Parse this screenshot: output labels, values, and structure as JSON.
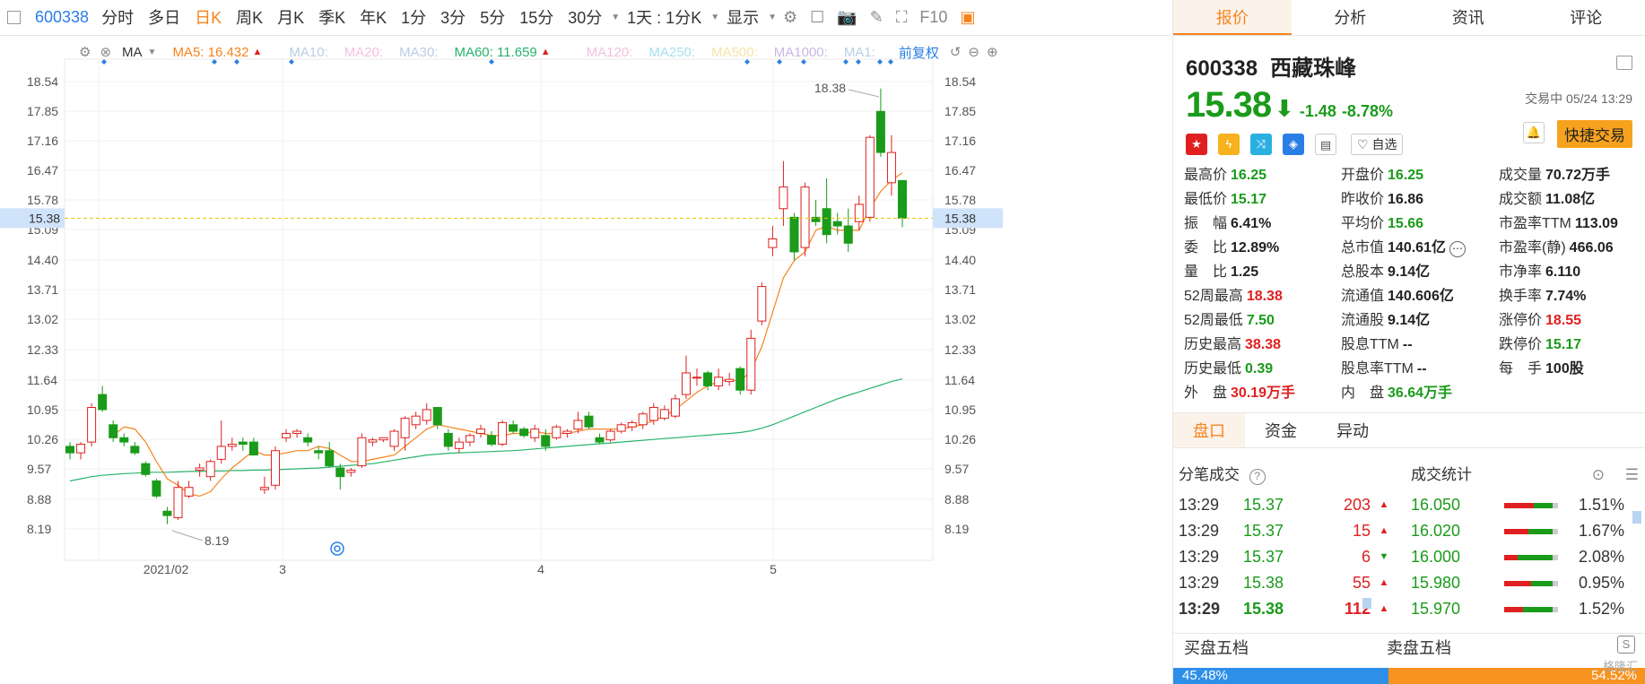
{
  "topbar": {
    "code": "600338",
    "periods": [
      "分时",
      "多日",
      "日K",
      "周K",
      "月K",
      "季K",
      "年K",
      "1分",
      "3分",
      "5分",
      "15分",
      "30分"
    ],
    "active_period": "日K",
    "multi_label": "1天 : 1分K",
    "display_label": "显示",
    "f10_label": "F10"
  },
  "indicator_bar": {
    "ma_label": "MA",
    "ma5": "MA5: 16.432",
    "ma10": "MA10:",
    "ma20": "MA20:",
    "ma30": "MA30:",
    "ma60": "MA60: 11.659",
    "ma120": "MA120:",
    "ma250": "MA250:",
    "ma500": "MA500:",
    "ma1000": "MA1000:",
    "ma1x": "MA1:",
    "adjust": "前复权"
  },
  "colors": {
    "up": "#e02020",
    "down": "#1a9b1a",
    "ma5": "#f7831e",
    "ma60": "#27b36c",
    "accent": "#f7831e"
  },
  "chart_data": {
    "type": "candlestick",
    "y_ticks": [
      "18.54",
      "17.85",
      "17.16",
      "16.47",
      "15.78",
      "15.09",
      "14.40",
      "13.71",
      "13.02",
      "12.33",
      "11.64",
      "10.95",
      "10.26",
      "9.57",
      "8.88",
      "8.19"
    ],
    "x_labels": [
      "2021/02",
      "3",
      "4",
      "5"
    ],
    "current_price_label": "15.38",
    "high_label": "18.38",
    "low_label": "8.19",
    "ylim": [
      7.9,
      18.9
    ],
    "candles": [
      [
        10.1,
        10.2,
        9.8,
        9.95
      ],
      [
        9.95,
        10.2,
        9.8,
        10.15
      ],
      [
        10.2,
        11.1,
        10.1,
        11.0
      ],
      [
        11.3,
        11.5,
        10.9,
        10.95
      ],
      [
        10.6,
        10.7,
        10.2,
        10.3
      ],
      [
        10.3,
        10.4,
        10.1,
        10.2
      ],
      [
        10.1,
        10.2,
        9.9,
        9.95
      ],
      [
        9.7,
        9.75,
        9.4,
        9.45
      ],
      [
        9.3,
        9.35,
        8.9,
        8.95
      ],
      [
        8.6,
        8.7,
        8.3,
        8.5
      ],
      [
        8.45,
        9.3,
        8.4,
        9.15
      ],
      [
        8.95,
        9.3,
        8.9,
        9.15
      ],
      [
        9.55,
        9.7,
        9.4,
        9.6
      ],
      [
        9.4,
        9.8,
        9.3,
        9.75
      ],
      [
        9.8,
        10.7,
        9.7,
        10.1
      ],
      [
        10.1,
        10.3,
        10.0,
        10.15
      ],
      [
        10.2,
        10.3,
        10.0,
        10.15
      ],
      [
        10.2,
        10.3,
        9.9,
        9.9
      ],
      [
        9.1,
        9.4,
        9.0,
        9.15
      ],
      [
        9.2,
        10.1,
        9.1,
        10.0
      ],
      [
        10.3,
        10.5,
        10.2,
        10.4
      ],
      [
        10.4,
        10.5,
        10.3,
        10.45
      ],
      [
        10.3,
        10.4,
        10.1,
        10.2
      ],
      [
        10.0,
        10.1,
        9.8,
        9.95
      ],
      [
        10.0,
        10.2,
        9.6,
        9.65
      ],
      [
        9.6,
        9.7,
        9.1,
        9.4
      ],
      [
        9.5,
        9.6,
        9.4,
        9.55
      ],
      [
        9.65,
        10.4,
        9.6,
        10.3
      ],
      [
        10.2,
        10.3,
        10.1,
        10.25
      ],
      [
        10.25,
        10.3,
        10.2,
        10.3
      ],
      [
        10.1,
        10.5,
        10.0,
        10.45
      ],
      [
        10.3,
        10.8,
        10.0,
        10.75
      ],
      [
        10.6,
        10.9,
        10.5,
        10.8
      ],
      [
        10.7,
        11.1,
        10.6,
        10.95
      ],
      [
        11.0,
        11.0,
        10.5,
        10.6
      ],
      [
        10.4,
        10.5,
        10.0,
        10.1
      ],
      [
        10.05,
        10.3,
        9.95,
        10.2
      ],
      [
        10.2,
        10.4,
        10.1,
        10.35
      ],
      [
        10.4,
        10.6,
        10.3,
        10.5
      ],
      [
        10.35,
        10.45,
        10.1,
        10.15
      ],
      [
        10.15,
        10.7,
        10.1,
        10.65
      ],
      [
        10.6,
        10.7,
        10.4,
        10.45
      ],
      [
        10.5,
        10.55,
        10.3,
        10.35
      ],
      [
        10.3,
        10.6,
        10.2,
        10.5
      ],
      [
        10.35,
        10.5,
        10.0,
        10.1
      ],
      [
        10.3,
        10.6,
        10.25,
        10.55
      ],
      [
        10.4,
        10.5,
        10.3,
        10.45
      ],
      [
        10.5,
        10.9,
        10.4,
        10.7
      ],
      [
        10.8,
        10.9,
        10.5,
        10.55
      ],
      [
        10.3,
        10.4,
        10.15,
        10.2
      ],
      [
        10.25,
        10.5,
        10.2,
        10.45
      ],
      [
        10.45,
        10.65,
        10.4,
        10.6
      ],
      [
        10.55,
        10.7,
        10.45,
        10.65
      ],
      [
        10.6,
        10.9,
        10.5,
        10.85
      ],
      [
        10.7,
        11.1,
        10.6,
        11.0
      ],
      [
        10.75,
        11.05,
        10.7,
        10.95
      ],
      [
        10.8,
        11.3,
        10.75,
        11.2
      ],
      [
        11.3,
        12.2,
        11.2,
        11.8
      ],
      [
        11.7,
        11.9,
        11.5,
        11.7
      ],
      [
        11.8,
        11.85,
        11.4,
        11.5
      ],
      [
        11.5,
        11.9,
        11.4,
        11.7
      ],
      [
        11.6,
        11.8,
        11.5,
        11.65
      ],
      [
        11.9,
        11.95,
        11.3,
        11.4
      ],
      [
        11.4,
        12.8,
        11.3,
        12.6
      ],
      [
        13.0,
        13.9,
        12.9,
        13.8
      ],
      [
        14.7,
        15.2,
        14.5,
        14.9
      ],
      [
        15.6,
        16.7,
        15.2,
        16.1
      ],
      [
        15.4,
        15.5,
        14.4,
        14.6
      ],
      [
        14.7,
        16.2,
        14.5,
        16.1
      ],
      [
        15.4,
        15.8,
        15.2,
        15.3
      ],
      [
        15.6,
        16.3,
        14.8,
        15.0
      ],
      [
        15.3,
        15.5,
        15.0,
        15.2
      ],
      [
        15.2,
        15.6,
        14.6,
        14.8
      ],
      [
        15.3,
        15.9,
        15.1,
        15.7
      ],
      [
        15.4,
        17.3,
        15.3,
        17.25
      ],
      [
        17.85,
        18.38,
        16.8,
        16.9
      ],
      [
        16.2,
        17.3,
        15.9,
        16.9
      ],
      [
        16.25,
        16.25,
        15.17,
        15.38
      ]
    ],
    "ma5": [
      null,
      null,
      null,
      null,
      10.35,
      10.55,
      10.5,
      10.2,
      9.75,
      9.35,
      9.2,
      9.0,
      8.95,
      9.05,
      9.35,
      9.6,
      9.8,
      10.0,
      9.9,
      9.9,
      9.95,
      10.0,
      10.0,
      10.1,
      10.05,
      9.9,
      9.75,
      9.75,
      9.8,
      9.85,
      9.9,
      10.1,
      10.3,
      10.5,
      10.6,
      10.55,
      10.5,
      10.45,
      10.4,
      10.35,
      10.35,
      10.4,
      10.4,
      10.45,
      10.4,
      10.4,
      10.4,
      10.45,
      10.5,
      10.5,
      10.5,
      10.5,
      10.55,
      10.6,
      10.7,
      10.8,
      10.95,
      11.15,
      11.35,
      11.5,
      11.6,
      11.65,
      11.6,
      11.85,
      12.4,
      13.2,
      14.0,
      14.4,
      14.6,
      15.1,
      15.2,
      15.1,
      15.1,
      15.1,
      15.6,
      16.0,
      16.25,
      16.43
    ],
    "ma60": [
      9.3,
      9.35,
      9.4,
      9.43,
      9.45,
      9.47,
      9.48,
      9.5,
      9.5,
      9.5,
      9.51,
      9.52,
      9.52,
      9.53,
      9.53,
      9.54,
      9.54,
      9.55,
      9.55,
      9.56,
      9.57,
      9.58,
      9.59,
      9.6,
      9.62,
      9.64,
      9.66,
      9.68,
      9.7,
      9.74,
      9.78,
      9.82,
      9.86,
      9.9,
      9.92,
      9.94,
      9.95,
      9.96,
      9.97,
      9.98,
      9.99,
      10.0,
      10.02,
      10.04,
      10.06,
      10.08,
      10.1,
      10.12,
      10.14,
      10.16,
      10.18,
      10.2,
      10.22,
      10.24,
      10.26,
      10.28,
      10.3,
      10.32,
      10.34,
      10.36,
      10.38,
      10.4,
      10.42,
      10.46,
      10.52,
      10.6,
      10.7,
      10.8,
      10.9,
      11.0,
      11.1,
      11.2,
      11.28,
      11.36,
      11.44,
      11.52,
      11.6,
      11.66
    ]
  },
  "right": {
    "tabs": [
      "报价",
      "分析",
      "资讯",
      "评论"
    ],
    "code": "600338",
    "name": "西藏珠峰",
    "price": "15.38",
    "arrow": "⬇",
    "change": "-1.48",
    "pct": "-8.78%",
    "trade_time": "交易中 05/24 13:29",
    "zixuan": "自选",
    "quick_trade": "快捷交易",
    "stats": [
      [
        "最高价",
        "16.25",
        "g",
        "开盘价",
        "16.25",
        "g",
        "成交量",
        "70.72万手",
        "k"
      ],
      [
        "最低价",
        "15.17",
        "g",
        "昨收价",
        "16.86",
        "k",
        "成交额",
        "11.08亿",
        "k"
      ],
      [
        "振　幅",
        "6.41%",
        "k",
        "平均价",
        "15.66",
        "g",
        "市盈率TTM",
        "113.09",
        "k"
      ],
      [
        "委　比",
        "12.89%",
        "k",
        "总市值",
        "140.61亿",
        "k",
        "市盈率(静)",
        "466.06",
        "k"
      ],
      [
        "量　比",
        "1.25",
        "k",
        "总股本",
        "9.14亿",
        "k",
        "市净率",
        "6.110",
        "k"
      ],
      [
        "52周最高",
        "18.38",
        "r",
        "流通值",
        "140.606亿",
        "k",
        "换手率",
        "7.74%",
        "k"
      ],
      [
        "52周最低",
        "7.50",
        "g",
        "流通股",
        "9.14亿",
        "k",
        "涨停价",
        "18.55",
        "r"
      ],
      [
        "历史最高",
        "38.38",
        "r",
        "股息TTM",
        "--",
        "k",
        "跌停价",
        "15.17",
        "g"
      ],
      [
        "历史最低",
        "0.39",
        "g",
        "股息率TTM",
        "--",
        "k",
        "每　手",
        "100股",
        "k"
      ],
      [
        "外　盘",
        "30.19万手",
        "r",
        "内　盘",
        "36.64万手",
        "g",
        "",
        "",
        " "
      ]
    ],
    "subtabs": [
      "盘口",
      "资金",
      "异动"
    ],
    "ticks_title": "分笔成交",
    "ticks": [
      [
        "13:29",
        "15.37",
        "203",
        "▲",
        "#e02020"
      ],
      [
        "13:29",
        "15.37",
        "15",
        "▲",
        "#e02020"
      ],
      [
        "13:29",
        "15.37",
        "6",
        "▼",
        "#1a9b1a"
      ],
      [
        "13:29",
        "15.38",
        "55",
        "▲",
        "#e02020"
      ],
      [
        "13:29",
        "15.38",
        "112",
        "▲",
        "#e02020"
      ]
    ],
    "deal_title": "成交统计",
    "deals": [
      [
        "16.050",
        "1.51%",
        0.55
      ],
      [
        "16.020",
        "1.67%",
        0.45
      ],
      [
        "16.000",
        "2.08%",
        0.25
      ],
      [
        "15.980",
        "0.95%",
        0.5
      ],
      [
        "15.970",
        "1.52%",
        0.35
      ]
    ],
    "buy5": "买盘五档",
    "sell5": "卖盘五档",
    "buy_ratio": "45.48%",
    "sell_ratio": "54.52%",
    "buy_ratio_value": 0.4548,
    "watermark": "格隆汇"
  }
}
